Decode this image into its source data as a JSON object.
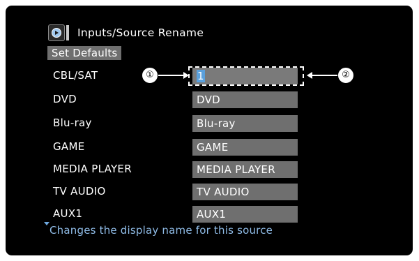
{
  "header": {
    "icon": "input-source-icon",
    "title": "Inputs/Source Rename"
  },
  "set_defaults_label": "Set Defaults",
  "rows": [
    {
      "label": "CBL/SAT",
      "value": "1",
      "editing": true
    },
    {
      "label": "DVD",
      "value": "DVD"
    },
    {
      "label": "Blu-ray",
      "value": "Blu-ray"
    },
    {
      "label": "GAME",
      "value": "GAME"
    },
    {
      "label": "MEDIA PLAYER",
      "value": "MEDIA PLAYER"
    },
    {
      "label": "TV AUDIO",
      "value": "TV AUDIO"
    },
    {
      "label": "AUX1",
      "value": "AUX1"
    }
  ],
  "callouts": {
    "one": "①",
    "two": "②"
  },
  "help_text": "Changes the display name for this source",
  "colors": {
    "screen_bg": "#000000",
    "field_bg": "#6f6f6f",
    "help_text": "#8fbbe6",
    "cursor": "#5aa0dc"
  }
}
